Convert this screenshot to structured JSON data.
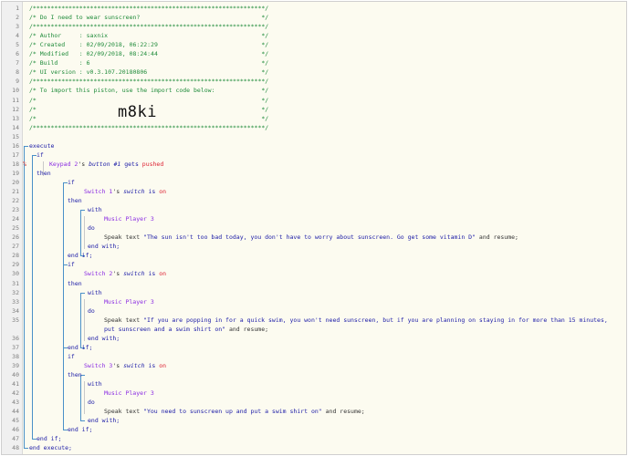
{
  "lines": [
    {
      "n": "1",
      "parts": [
        {
          "t": "/*****************************************************************/",
          "c": "cm"
        }
      ]
    },
    {
      "n": "2",
      "parts": [
        {
          "t": "/* Do I need to wear sunscreen?                                  */",
          "c": "cm"
        }
      ]
    },
    {
      "n": "3",
      "parts": [
        {
          "t": "/*****************************************************************/",
          "c": "cm"
        }
      ]
    },
    {
      "n": "4",
      "parts": [
        {
          "t": "/* Author     : saxnix                                           */",
          "c": "cm"
        }
      ]
    },
    {
      "n": "5",
      "parts": [
        {
          "t": "/* Created    : 02/09/2018, 06:22:29                             */",
          "c": "cm"
        }
      ]
    },
    {
      "n": "6",
      "parts": [
        {
          "t": "/* Modified   : 02/09/2018, 08:24:44                             */",
          "c": "cm"
        }
      ]
    },
    {
      "n": "7",
      "parts": [
        {
          "t": "/* Build      : 6                                                */",
          "c": "cm"
        }
      ]
    },
    {
      "n": "8",
      "parts": [
        {
          "t": "/* UI version : v0.3.107.20180806                                */",
          "c": "cm"
        }
      ]
    },
    {
      "n": "9",
      "parts": [
        {
          "t": "/*****************************************************************/",
          "c": "cm"
        }
      ]
    },
    {
      "n": "10",
      "parts": [
        {
          "t": "/* To import this piston, use the import code below:             */",
          "c": "cm"
        }
      ]
    },
    {
      "n": "11",
      "parts": [
        {
          "t": "/*                                                               */",
          "c": "cm"
        }
      ]
    },
    {
      "n": "12",
      "parts": [
        {
          "t": "/*                                                               */",
          "c": "cm"
        }
      ],
      "big": "m8ki"
    },
    {
      "n": "13",
      "parts": [
        {
          "t": "/*                                                               */",
          "c": "cm"
        }
      ]
    },
    {
      "n": "14",
      "parts": [
        {
          "t": "/*****************************************************************/",
          "c": "cm"
        }
      ]
    },
    {
      "n": "15",
      "parts": []
    },
    {
      "n": "16",
      "parts": [
        {
          "t": "execute",
          "c": "kw"
        }
      ]
    },
    {
      "n": "17",
      "indent": 1,
      "parts": [
        {
          "t": "if",
          "c": "kw"
        }
      ]
    },
    {
      "n": "18",
      "indent": 2,
      "bp": "%",
      "parts": [
        {
          "t": "Keypad 2",
          "c": "dev"
        },
        {
          "t": "'s ",
          "c": "plain"
        },
        {
          "t": "button #1",
          "c": "attr"
        },
        {
          "t": " gets ",
          "c": "kw"
        },
        {
          "t": "pushed",
          "c": "val"
        }
      ]
    },
    {
      "n": "19",
      "indent": 1,
      "parts": [
        {
          "t": "then",
          "c": "kw"
        }
      ]
    },
    {
      "n": "20",
      "indent": 3,
      "parts": [
        {
          "t": "if",
          "c": "kw"
        }
      ]
    },
    {
      "n": "21",
      "indent": 4,
      "parts": [
        {
          "t": "Switch 1",
          "c": "dev"
        },
        {
          "t": "'s ",
          "c": "plain"
        },
        {
          "t": "switch",
          "c": "attr"
        },
        {
          "t": " is ",
          "c": "kw"
        },
        {
          "t": "on",
          "c": "val"
        }
      ]
    },
    {
      "n": "22",
      "indent": 3,
      "parts": [
        {
          "t": "then",
          "c": "kw"
        }
      ]
    },
    {
      "n": "23",
      "indent": 5,
      "parts": [
        {
          "t": "with",
          "c": "kw"
        }
      ]
    },
    {
      "n": "24",
      "indent": 6,
      "parts": [
        {
          "t": "Music Player 3",
          "c": "dev"
        }
      ]
    },
    {
      "n": "25",
      "indent": 5,
      "parts": [
        {
          "t": "do",
          "c": "kw"
        }
      ]
    },
    {
      "n": "26",
      "indent": 6,
      "parts": [
        {
          "t": "Speak text ",
          "c": "plain"
        },
        {
          "t": "\"The sun isn't too bad today, you don't have to worry about sunscreen. Go get some vitamin D\"",
          "c": "str"
        },
        {
          "t": " and resume;",
          "c": "plain"
        }
      ]
    },
    {
      "n": "27",
      "indent": 5,
      "parts": [
        {
          "t": "end with;",
          "c": "kw"
        }
      ]
    },
    {
      "n": "28",
      "indent": 3,
      "parts": [
        {
          "t": "end if;",
          "c": "kw"
        }
      ]
    },
    {
      "n": "29",
      "indent": 3,
      "parts": [
        {
          "t": "if",
          "c": "kw"
        }
      ]
    },
    {
      "n": "30",
      "indent": 4,
      "parts": [
        {
          "t": "Switch 2",
          "c": "dev"
        },
        {
          "t": "'s ",
          "c": "plain"
        },
        {
          "t": "switch",
          "c": "attr"
        },
        {
          "t": " is ",
          "c": "kw"
        },
        {
          "t": "on",
          "c": "val"
        }
      ]
    },
    {
      "n": "31",
      "indent": 3,
      "parts": [
        {
          "t": "then",
          "c": "kw"
        }
      ]
    },
    {
      "n": "32",
      "indent": 5,
      "parts": [
        {
          "t": "with",
          "c": "kw"
        }
      ]
    },
    {
      "n": "33",
      "indent": 6,
      "parts": [
        {
          "t": "Music Player 3",
          "c": "dev"
        }
      ]
    },
    {
      "n": "34",
      "indent": 5,
      "parts": [
        {
          "t": "do",
          "c": "kw"
        }
      ]
    },
    {
      "n": "35",
      "indent": 6,
      "parts": [
        {
          "t": "Speak text ",
          "c": "plain"
        },
        {
          "t": "\"If you are popping in for a quick swim, you won't need sunscreen, but if you are planning on staying in for more than 15 minutes,",
          "c": "str"
        }
      ]
    },
    {
      "n": "",
      "indent": 6,
      "parts": [
        {
          "t": "put sunscreen and a swim shirt on\"",
          "c": "str"
        },
        {
          "t": " and resume;",
          "c": "plain"
        }
      ]
    },
    {
      "n": "36",
      "indent": 5,
      "parts": [
        {
          "t": "end with;",
          "c": "kw"
        }
      ]
    },
    {
      "n": "37",
      "indent": 3,
      "parts": [
        {
          "t": "end if;",
          "c": "kw"
        }
      ]
    },
    {
      "n": "38",
      "indent": 3,
      "parts": [
        {
          "t": "if",
          "c": "kw"
        }
      ]
    },
    {
      "n": "39",
      "indent": 4,
      "parts": [
        {
          "t": "Switch 3",
          "c": "dev"
        },
        {
          "t": "'s ",
          "c": "plain"
        },
        {
          "t": "switch",
          "c": "attr"
        },
        {
          "t": " is ",
          "c": "kw"
        },
        {
          "t": "on",
          "c": "val"
        }
      ]
    },
    {
      "n": "40",
      "indent": 3,
      "parts": [
        {
          "t": "then",
          "c": "kw"
        }
      ]
    },
    {
      "n": "41",
      "indent": 5,
      "parts": [
        {
          "t": "with",
          "c": "kw"
        }
      ]
    },
    {
      "n": "42",
      "indent": 6,
      "parts": [
        {
          "t": "Music Player 3",
          "c": "dev"
        }
      ]
    },
    {
      "n": "43",
      "indent": 5,
      "parts": [
        {
          "t": "do",
          "c": "kw"
        }
      ]
    },
    {
      "n": "44",
      "indent": 6,
      "parts": [
        {
          "t": "Speak text ",
          "c": "plain"
        },
        {
          "t": "\"You need to sunscreen up and put a swim shirt on\"",
          "c": "str"
        },
        {
          "t": " and resume;",
          "c": "plain"
        }
      ]
    },
    {
      "n": "45",
      "indent": 5,
      "parts": [
        {
          "t": "end with;",
          "c": "kw"
        }
      ]
    },
    {
      "n": "46",
      "indent": 3,
      "parts": [
        {
          "t": "end if;",
          "c": "kw"
        }
      ]
    },
    {
      "n": "47",
      "indent": 1,
      "parts": [
        {
          "t": "end if;",
          "c": "kw"
        }
      ]
    },
    {
      "n": "48",
      "parts": [
        {
          "t": "end execute;",
          "c": "kw"
        }
      ]
    }
  ]
}
